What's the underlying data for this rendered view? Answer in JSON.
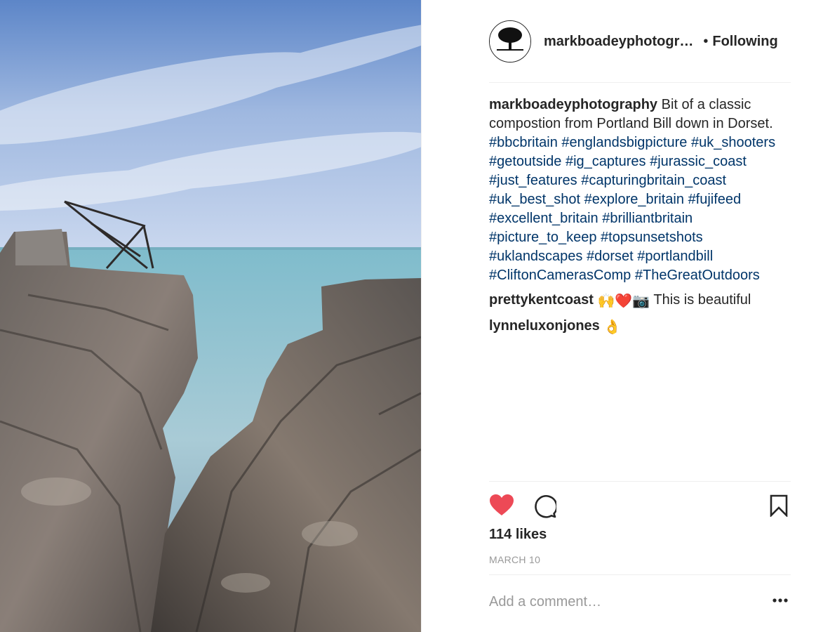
{
  "post": {
    "username_short": "markboadeyphotogr…",
    "separator": "•",
    "follow_status": "Following",
    "caption": {
      "username": "markboadeyphotography",
      "text": "Bit of a classic compostion from Portland Bill down in Dorset.",
      "hashtags": [
        "#bbcbritain",
        "#englandsbigpicture",
        "#uk_shooters",
        "#getoutside",
        "#ig_captures",
        "#jurassic_coast",
        "#just_features",
        "#capturingbritain_coast",
        "#uk_best_shot",
        "#explore_britain",
        "#fujifeed",
        "#excellent_britain",
        "#brilliantbritain",
        "#picture_to_keep",
        "#topsunsetshots",
        "#uklandscapes",
        "#dorset",
        "#portlandbill",
        "#CliftonCamerasComp",
        "#TheGreatOutdoors"
      ]
    },
    "comments": [
      {
        "username": "prettykentcoast",
        "emoji": "🙌❤️📷",
        "text": "This is beautiful"
      },
      {
        "username": "lynneluxonjones",
        "emoji": "👌",
        "text": ""
      }
    ],
    "likes": "114 likes",
    "date": "MARCH 10",
    "comment_placeholder": "Add a comment…",
    "liked": true
  },
  "colors": {
    "heart": "#ed4956",
    "hashtag": "#003569",
    "muted": "#999999",
    "text": "#262626"
  },
  "icons": [
    "heart-icon",
    "comment-icon",
    "bookmark-icon",
    "more-options-icon"
  ]
}
